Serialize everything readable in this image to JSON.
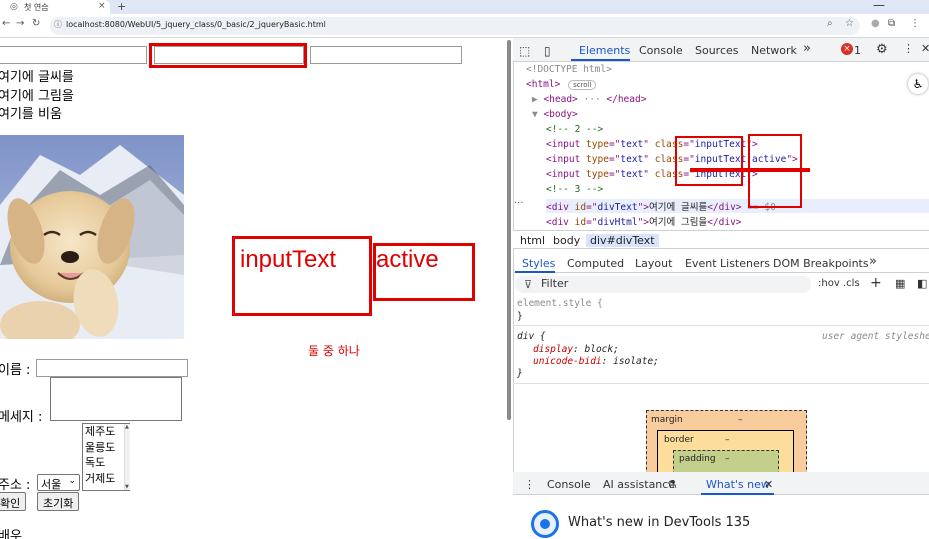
{
  "browser": {
    "tab_title": "첫 연습",
    "tab_close": "×",
    "new_tab": "+",
    "minimize": "—",
    "url": "localhost:8080/WebUI/5_jquery_class/0_basic/2_jqueryBasic.html"
  },
  "page": {
    "div_text": "여기에 글씨를",
    "div_html": "여기에 그림을",
    "div_empty": "여기를 비움",
    "label_inputtext": "inputText",
    "label_active": "active",
    "label_one_of_two": "둘 중 하나",
    "name_label": "이름 :",
    "message_label": "메세지 :",
    "address_label": "주소 :",
    "address_select_value": "서울",
    "listbox_options": [
      "제주도",
      "울릉도",
      "독도",
      "거제도"
    ],
    "confirm_button": "확인",
    "reset_button": "초기화",
    "bottom_text": "배우"
  },
  "devtools": {
    "tabs": [
      "Elements",
      "Console",
      "Sources",
      "Network"
    ],
    "more_tabs": "»",
    "error_count": "1",
    "code_lines": [
      {
        "parts": [
          [
            "c-gray",
            "<!DOCTYPE html>"
          ]
        ]
      },
      {
        "parts": [
          [
            "c-tag",
            "<html>"
          ],
          [
            "c-gray",
            " "
          ]
        ],
        "badge": "scroll"
      },
      {
        "parts": [
          [
            "c-gray",
            "▶ "
          ],
          [
            "c-tag",
            "<head>"
          ],
          [
            "c-gray",
            " ··· "
          ],
          [
            "c-tag",
            "</head>"
          ]
        ]
      },
      {
        "parts": [
          [
            "c-gray",
            "▼ "
          ],
          [
            "c-tag",
            "<body>"
          ]
        ]
      },
      {
        "parts": [
          [
            "c-comment",
            "<!-- 2 -->"
          ]
        ]
      },
      {
        "parts": [
          [
            "c-tag",
            "<input "
          ],
          [
            "c-attr",
            "type"
          ],
          [
            "c-tag",
            "=\""
          ],
          [
            "c-val",
            "text"
          ],
          [
            "c-tag",
            "\" "
          ],
          [
            "c-attr",
            "class"
          ],
          [
            "c-tag",
            "=\""
          ],
          [
            "c-val",
            "inputText"
          ],
          [
            "c-tag",
            "\">"
          ]
        ]
      },
      {
        "parts": [
          [
            "c-tag",
            "<input "
          ],
          [
            "c-attr",
            "type"
          ],
          [
            "c-tag",
            "=\""
          ],
          [
            "c-val",
            "text"
          ],
          [
            "c-tag",
            "\" "
          ],
          [
            "c-attr",
            "class"
          ],
          [
            "c-tag",
            "=\""
          ],
          [
            "c-val",
            "inputText active"
          ],
          [
            "c-tag",
            "\">"
          ]
        ]
      },
      {
        "parts": [
          [
            "c-tag",
            "<input "
          ],
          [
            "c-attr",
            "type"
          ],
          [
            "c-tag",
            "=\""
          ],
          [
            "c-val",
            "text"
          ],
          [
            "c-tag",
            "\" "
          ],
          [
            "c-attr",
            "class"
          ],
          [
            "c-tag",
            "=\""
          ],
          [
            "c-val",
            "inputText"
          ],
          [
            "c-tag",
            "\">"
          ]
        ]
      },
      {
        "parts": [
          [
            "c-comment",
            "<!-- 3 -->"
          ]
        ]
      },
      {
        "parts": [
          [
            "c-tag",
            "<div "
          ],
          [
            "c-attr",
            "id"
          ],
          [
            "c-tag",
            "=\""
          ],
          [
            "c-val",
            "divText"
          ],
          [
            "c-tag",
            "\">"
          ],
          [
            "c-text",
            "여기에 글씨를"
          ],
          [
            "c-tag",
            "</div>"
          ],
          [
            "c-gray",
            " == $0"
          ]
        ]
      },
      {
        "parts": [
          [
            "c-tag",
            "<div "
          ],
          [
            "c-attr",
            "id"
          ],
          [
            "c-tag",
            "=\""
          ],
          [
            "c-val",
            "divHtml"
          ],
          [
            "c-tag",
            "\">"
          ],
          [
            "c-text",
            "여기에 그림을"
          ],
          [
            "c-tag",
            "</div>"
          ]
        ]
      }
    ],
    "breadcrumbs": [
      "html",
      "body",
      "div#divText"
    ],
    "styles_tabs": [
      "Styles",
      "Computed",
      "Layout",
      "Event Listeners",
      "DOM Breakpoints"
    ],
    "filter_placeholder": "Filter",
    "hov": ":hov",
    "cls": ".cls",
    "element_style_open": "element.style {",
    "close_brace": "}",
    "div_rule_selector": "div {",
    "ua_label": "user agent styleshee",
    "prop1_name": "display",
    "prop1_value": "block;",
    "prop2_name": "unicode-bidi",
    "prop2_value": "isolate;",
    "box_margin": "margin",
    "box_border": "border",
    "box_padding": "padding",
    "box_dash": "–",
    "drawer_tabs": [
      "Console",
      "AI assistance",
      "What's new"
    ],
    "whats_new_title": "What's new in DevTools 135"
  }
}
